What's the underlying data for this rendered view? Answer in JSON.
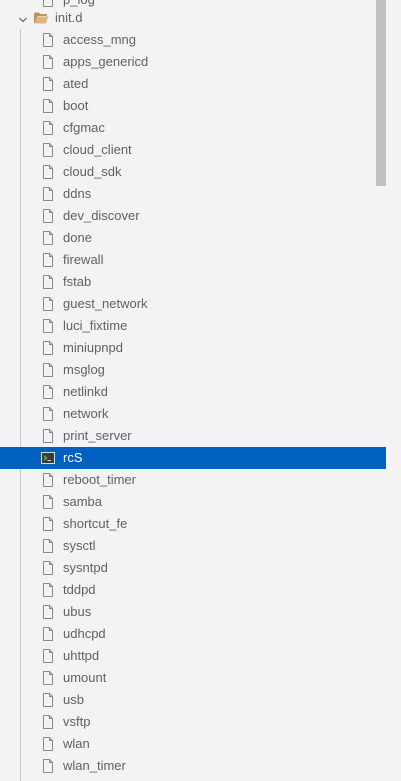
{
  "explorer": {
    "partial_item": "p_log",
    "folder": {
      "name": "init.d",
      "expanded": true,
      "icon": "folder-open-icon",
      "icon_color": "#dcb67a"
    },
    "selected_color": "#0060c0",
    "files": [
      {
        "name": "access_mng",
        "icon": "file-icon"
      },
      {
        "name": "apps_genericd",
        "icon": "file-icon"
      },
      {
        "name": "ated",
        "icon": "file-icon"
      },
      {
        "name": "boot",
        "icon": "file-icon"
      },
      {
        "name": "cfgmac",
        "icon": "file-icon"
      },
      {
        "name": "cloud_client",
        "icon": "file-icon"
      },
      {
        "name": "cloud_sdk",
        "icon": "file-icon"
      },
      {
        "name": "ddns",
        "icon": "file-icon"
      },
      {
        "name": "dev_discover",
        "icon": "file-icon"
      },
      {
        "name": "done",
        "icon": "file-icon"
      },
      {
        "name": "firewall",
        "icon": "file-icon"
      },
      {
        "name": "fstab",
        "icon": "file-icon"
      },
      {
        "name": "guest_network",
        "icon": "file-icon"
      },
      {
        "name": "luci_fixtime",
        "icon": "file-icon"
      },
      {
        "name": "miniupnpd",
        "icon": "file-icon"
      },
      {
        "name": "msglog",
        "icon": "file-icon"
      },
      {
        "name": "netlinkd",
        "icon": "file-icon"
      },
      {
        "name": "network",
        "icon": "file-icon"
      },
      {
        "name": "print_server",
        "icon": "file-icon"
      },
      {
        "name": "rcS",
        "icon": "terminal-file-icon",
        "selected": true
      },
      {
        "name": "reboot_timer",
        "icon": "file-icon"
      },
      {
        "name": "samba",
        "icon": "file-icon"
      },
      {
        "name": "shortcut_fe",
        "icon": "file-icon"
      },
      {
        "name": "sysctl",
        "icon": "file-icon"
      },
      {
        "name": "sysntpd",
        "icon": "file-icon"
      },
      {
        "name": "tddpd",
        "icon": "file-icon"
      },
      {
        "name": "ubus",
        "icon": "file-icon"
      },
      {
        "name": "udhcpd",
        "icon": "file-icon"
      },
      {
        "name": "uhttpd",
        "icon": "file-icon"
      },
      {
        "name": "umount",
        "icon": "file-icon"
      },
      {
        "name": "usb",
        "icon": "file-icon"
      },
      {
        "name": "vsftp",
        "icon": "file-icon"
      },
      {
        "name": "wlan",
        "icon": "file-icon"
      },
      {
        "name": "wlan_timer",
        "icon": "file-icon"
      }
    ]
  }
}
